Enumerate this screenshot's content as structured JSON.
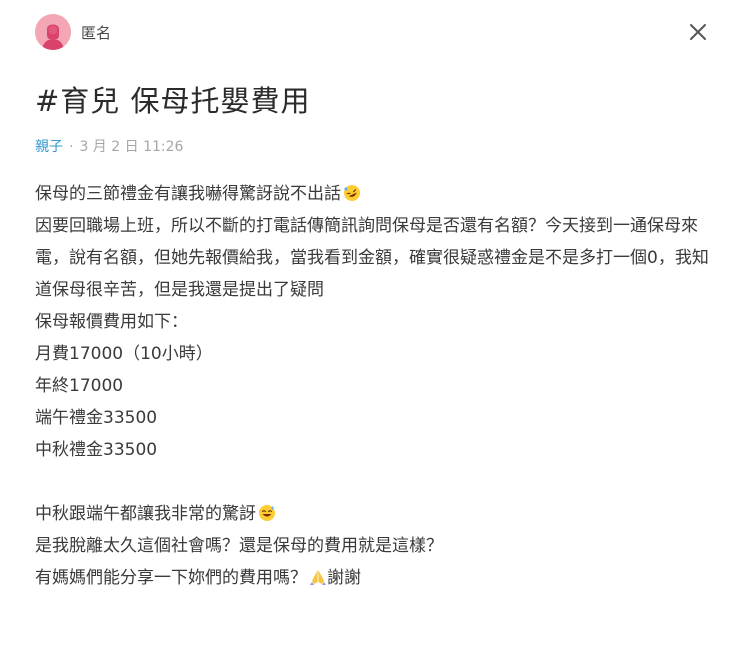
{
  "author": {
    "name": "匿名",
    "avatar_icon": "female-silhouette-avatar",
    "avatar_color": "#f4a6b4"
  },
  "close_icon": "close-icon",
  "post": {
    "title": "#育兒 保母托嬰費用",
    "board": "親子",
    "separator": "·",
    "timestamp": "3 月 2 日 11:26"
  },
  "content": {
    "line1": "保母的三節禮金有讓我嚇得驚訝說不出話",
    "line1_emoji": "rofl-emoji",
    "paragraph2": "因要回職場上班，所以不斷的打電話傳簡訊詢問保母是否還有名額？今天接到一通保母來電，說有名額，但她先報價給我，當我看到金額，確實很疑惑禮金是不是多打一個0，我知道保母很辛苦，但是我還是提出了疑問",
    "line3": "保母報價費用如下：",
    "line4": "月費17000（10小時）",
    "line5": "年終17000",
    "line6": "端午禮金33500",
    "line7": "中秋禮金33500",
    "line8": "中秋跟端午都讓我非常的驚訝",
    "line8_emoji": "sweat-smile-emoji",
    "line9": "是我脫離太久這個社會嗎？還是保母的費用就是這樣？",
    "line10": "有媽媽們能分享一下妳們的費用嗎？",
    "line10_emoji": "folded-hands-emoji",
    "line10_suffix": "謝謝"
  }
}
